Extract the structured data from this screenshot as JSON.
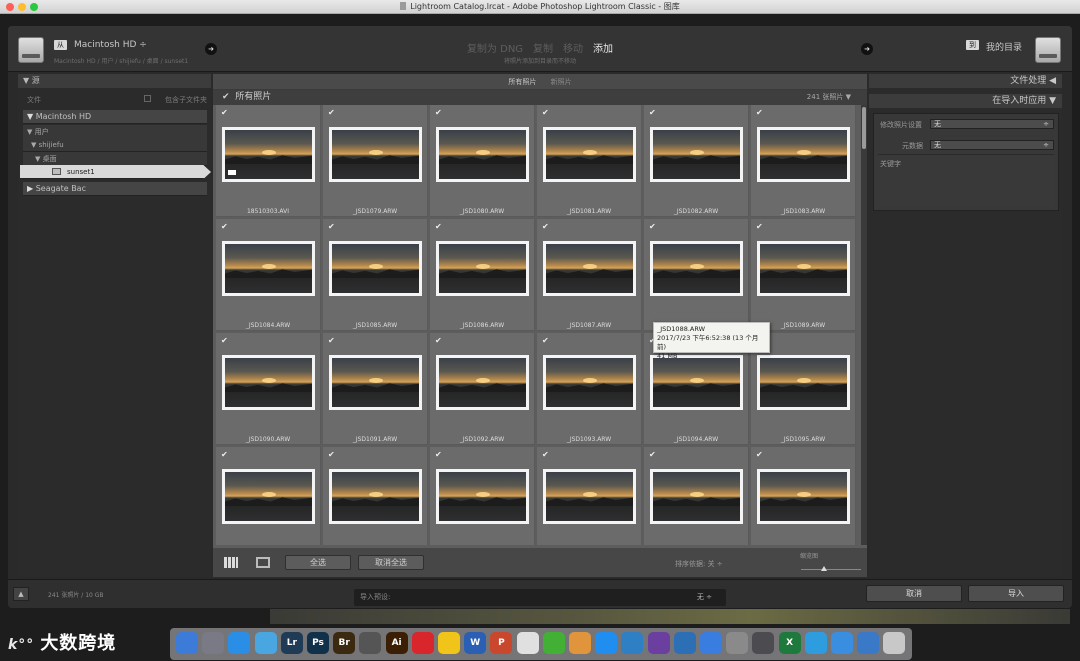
{
  "window": {
    "title": "Lightroom Catalog.lrcat - Adobe Photoshop Lightroom Classic - 图库"
  },
  "header": {
    "from_badge": "从",
    "from_title": "Macintosh HD ÷",
    "from_path": "Macintosh HD / 用户 / shijiefu / 桌面 / sunset1",
    "modes": [
      {
        "label": "复制为 DNG",
        "active": false
      },
      {
        "label": "复制",
        "active": false
      },
      {
        "label": "移动",
        "active": false
      },
      {
        "label": "添加",
        "active": true
      }
    ],
    "mode_description": "将照片添加到目录而不移动",
    "to_badge": "到",
    "to_title": "我的目录"
  },
  "source_panel": {
    "header": "▼ 源",
    "files_label": "文件",
    "include_subfolders": "包含子文件夹",
    "tree": {
      "macintosh_hd": "Macintosh HD",
      "users": "▼  用户",
      "shijiefu": "▼  shijiefu",
      "desktop": "▼  桌面",
      "sunset1": "sunset1",
      "seagate": "Seagate Bac"
    }
  },
  "grid": {
    "filters": [
      "所有照片",
      "新照片"
    ],
    "header_title": "所有照片",
    "count": "241 张照片",
    "photos": [
      {
        "name": "18510303.AVI",
        "video": true
      },
      {
        "name": "_JSD1079.ARW"
      },
      {
        "name": "_JSD1080.ARW"
      },
      {
        "name": "_JSD1081.ARW"
      },
      {
        "name": "_JSD1082.ARW"
      },
      {
        "name": "_JSD1083.ARW"
      },
      {
        "name": "_JSD1084.ARW"
      },
      {
        "name": "_JSD1085.ARW"
      },
      {
        "name": "_JSD1086.ARW"
      },
      {
        "name": "_JSD1087.ARW"
      },
      {
        "name": "_JSD1088.ARW"
      },
      {
        "name": "_JSD1089.ARW"
      },
      {
        "name": "_JSD1090.ARW"
      },
      {
        "name": "_JSD1091.ARW"
      },
      {
        "name": "_JSD1092.ARW"
      },
      {
        "name": "_JSD1093.ARW"
      },
      {
        "name": "_JSD1094.ARW"
      },
      {
        "name": "_JSD1095.ARW"
      },
      {
        "name": ""
      },
      {
        "name": ""
      },
      {
        "name": ""
      },
      {
        "name": ""
      },
      {
        "name": ""
      },
      {
        "name": ""
      }
    ],
    "tooltip": {
      "name": "_JSD1088.ARW",
      "date": "2017/7/23 下午6:52:38 (13 个月前)",
      "size": "41 MB"
    },
    "toolbar": {
      "select_all": "全选",
      "deselect_all": "取消全选",
      "sort_label": "排序依据:  关 ÷",
      "thumbnail_label": "缩览图"
    }
  },
  "right_panel": {
    "file_handling": "文件处理 ◀",
    "apply_during_import": "在导入时应用 ▼",
    "develop_settings_label": "修改照片设置",
    "develop_settings_value": "无",
    "metadata_label": "元数据",
    "metadata_value": "无",
    "keywords_label": "关键字"
  },
  "bottom": {
    "collapse": "▲",
    "summary": "241 张照片 / 10 GB",
    "preset_label": "导入预设:",
    "preset_value": "无 ÷",
    "cancel": "取消",
    "import": "导入"
  },
  "dock": [
    {
      "label": "",
      "color": "#3d7bd9"
    },
    {
      "label": "",
      "color": "#7a7a86"
    },
    {
      "label": "",
      "color": "#2b8ee6"
    },
    {
      "label": "",
      "color": "#4aa6e0"
    },
    {
      "label": "Lr",
      "color": "#1f3b56"
    },
    {
      "label": "Ps",
      "color": "#113049"
    },
    {
      "label": "Br",
      "color": "#3b2a10"
    },
    {
      "label": "",
      "color": "#555"
    },
    {
      "label": "Ai",
      "color": "#3b1f05"
    },
    {
      "label": "",
      "color": "#d9252c"
    },
    {
      "label": "",
      "color": "#f0c419"
    },
    {
      "label": "W",
      "color": "#2b5fb4"
    },
    {
      "label": "P",
      "color": "#c9472c"
    },
    {
      "label": "",
      "color": "#e0e0e0"
    },
    {
      "label": "",
      "color": "#41b035"
    },
    {
      "label": "",
      "color": "#e0943c"
    },
    {
      "label": "",
      "color": "#1f8ef0"
    },
    {
      "label": "",
      "color": "#2f7fc5"
    },
    {
      "label": "",
      "color": "#6b3fa0"
    },
    {
      "label": "",
      "color": "#2d6fb5"
    },
    {
      "label": "",
      "color": "#3a7de0"
    },
    {
      "label": "",
      "color": "#8a8a8a"
    },
    {
      "label": "",
      "color": "#4b4b50"
    },
    {
      "label": "X",
      "color": "#1e7a3c"
    },
    {
      "label": "",
      "color": "#2d9de0"
    },
    {
      "label": "",
      "color": "#3a8ee0"
    },
    {
      "label": "",
      "color": "#3a78c8"
    },
    {
      "label": "",
      "color": "#c8c8c8"
    }
  ],
  "watermark": {
    "logo": "k°°",
    "text": "大数跨境"
  }
}
